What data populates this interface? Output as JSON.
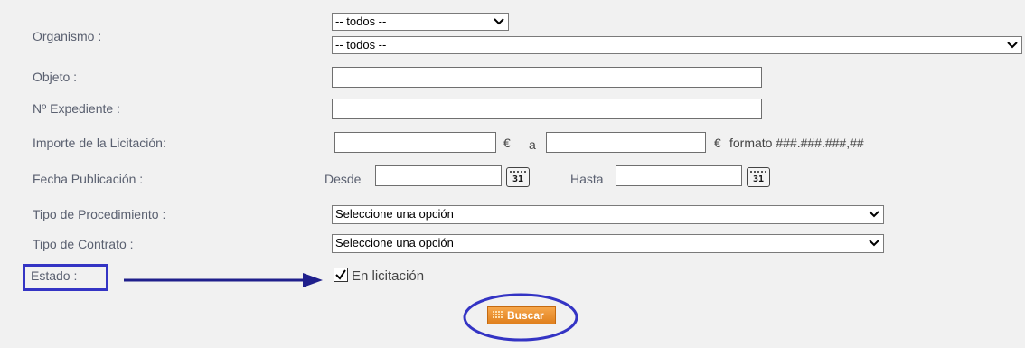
{
  "organismo": {
    "label": "Organismo :",
    "select1_value": "-- todos --",
    "select2_value": "-- todos --"
  },
  "objeto": {
    "label": "Objeto :",
    "value": ""
  },
  "expediente": {
    "label": "Nº Expediente :",
    "value": ""
  },
  "importe": {
    "label": "Importe de la Licitación:",
    "currency1": "€",
    "sep": "a",
    "currency2": "€",
    "format_hint": "formato ###.###.###,##"
  },
  "fecha": {
    "label": "Fecha Publicación :",
    "desde_label": "Desde",
    "hasta_label": "Hasta",
    "calendar_day": "31"
  },
  "procedimiento": {
    "label": "Tipo de Procedimiento :",
    "value": "Seleccione una opción"
  },
  "contrato": {
    "label": "Tipo de Contrato :",
    "value": "Seleccione una opción"
  },
  "estado": {
    "label": "Estado :",
    "checkbox_label": "En licitación",
    "checked": true
  },
  "search": {
    "label": "Buscar"
  },
  "colors": {
    "annotation": "#3434c4",
    "button": "#e8902e",
    "label_text": "#5a6070"
  }
}
